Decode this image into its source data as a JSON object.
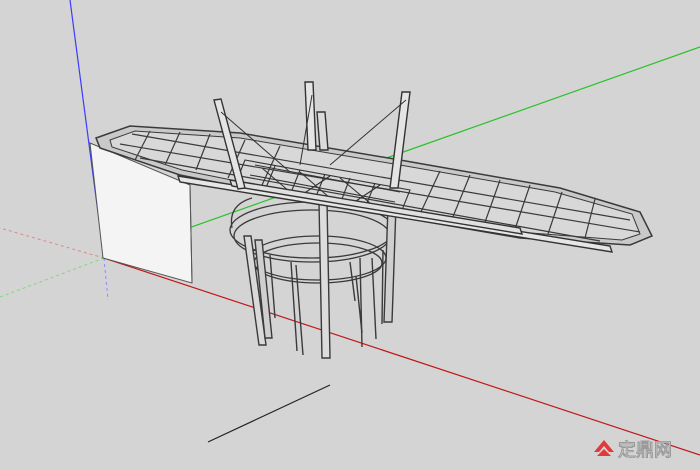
{
  "viewport": {
    "background_color": "#d4d4d4",
    "axis_colors": {
      "blue": "#3b3bff",
      "green": "#27c227",
      "red": "#c01818"
    }
  },
  "model": {
    "description_icon": "canopy-structure-icon",
    "stroke_color": "#3a3a3a",
    "glass_color": "#c9c9c9",
    "wall_color": "#f4f4f4"
  },
  "watermark": {
    "text": "定鼎网",
    "logo_icon": "dingding-logo-icon",
    "logo_color": "#e03a3a"
  }
}
